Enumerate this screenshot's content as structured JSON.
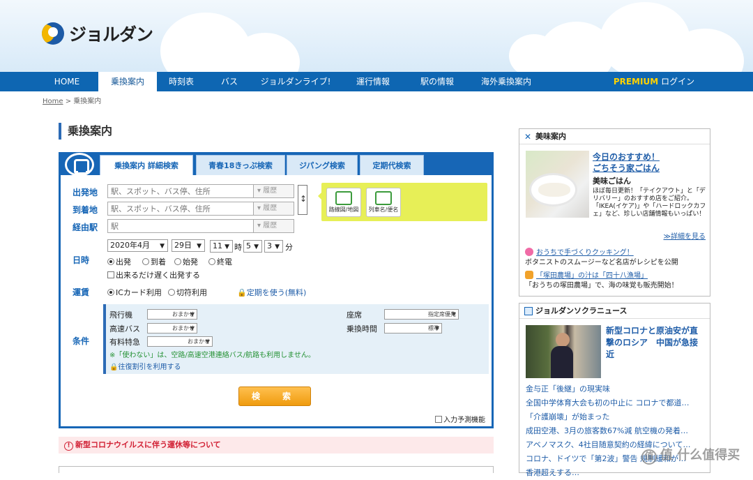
{
  "brand": {
    "name": "ジョルダン"
  },
  "nav": {
    "items": [
      "HOME",
      "乗換案内",
      "時刻表",
      "バス",
      "ジョルダンライブ!",
      "運行情報",
      "駅の情報",
      "海外乗換案内"
    ],
    "premium": "PREMIUM",
    "login": "ログイン"
  },
  "breadcrumb": {
    "home": "Home",
    "separator": ">",
    "current": "乗換案内"
  },
  "page": {
    "title": "乗換案内"
  },
  "search": {
    "tabs": [
      "乗換案内 詳細検索",
      "青春18きっぷ検索",
      "ジパング検索",
      "定期代検索"
    ],
    "labels": {
      "departure": "出発地",
      "arrival": "到着地",
      "via": "経由駅",
      "date": "日時",
      "fare": "運賃",
      "conditions": "条件"
    },
    "placeholders": {
      "departure": "駅、スポット、バス停、住所",
      "arrival": "駅、スポット、バス停、住所",
      "via": "駅"
    },
    "history": "履歴",
    "route_map": "路線図/地図",
    "train_name": "列車名/便名",
    "date": {
      "year_month": "2020年4月",
      "day": "29日",
      "hour": "11",
      "hour_unit": "時",
      "minute_tens": "5",
      "minute_ones": "3",
      "minute_unit": "分"
    },
    "time_options": [
      "出発",
      "到着",
      "始発",
      "終電"
    ],
    "late_departure": "出来るだけ遅く出発する",
    "fare_options": [
      "ICカード利用",
      "切符利用"
    ],
    "commuter_pass": "定期を使う(無料)",
    "conditions": {
      "flight": "飛行機",
      "express_bus": "高速バス",
      "limited_express": "有料特急",
      "default": "おまかせ",
      "seat": "座席",
      "seat_value": "指定席優先",
      "transfer_time": "乗換時間",
      "transfer_value": "標準",
      "note": "※「使わない」は、空路/高速空港連絡バス/航路も利用しません。",
      "round_trip": "往復割引を利用する"
    },
    "search_button": "検　索",
    "autocomplete": "入力予測機能"
  },
  "notice": {
    "text": "新型コロナウイルスに伴う運休等について",
    "icon": "!"
  },
  "gourmet": {
    "title": "美味案内",
    "headline1": "今日のおすすめ！",
    "headline2": "ごちそう家ごはん",
    "subtitle": "美味ごはん",
    "description": "ほぼ毎日更新！「テイクアウト」と「デリバリー」のおすすめ店をご紹介。「IKEA(イケア)」や「ハードロックカフェ」など、珍しい店舗情報もいっぱい！",
    "more": "≫詳細を見る",
    "feature1_link": "おうちで手づくりクッキング！",
    "feature1_text": "ボタニストのスムージーなど名店がレシピを公開",
    "feature2_link": "「塚田農場」の汁は「四十八漁場」",
    "feature2_text": "「おうちの塚田農場」で、海の味覚も販売開始！"
  },
  "news": {
    "title": "ジョルダンソクラニュース",
    "headline": "新型コロナと原油安が直撃のロシア　中国が急接近",
    "items": [
      "金与正「後継」の現実味",
      "全国中学体育大会も初の中止に コロナで都道…",
      "「介護崩壊」が始まった",
      "成田空港、3月の旅客数67%減 航空機の発着…",
      "アベノマスク、4社目随意契約の経緯について…",
      "コロナ、ドイツで「第2波」警告 規制緩和が…",
      "香港超えする…"
    ]
  },
  "watermark": {
    "text": "值 什么值得买",
    "icon": "值"
  }
}
